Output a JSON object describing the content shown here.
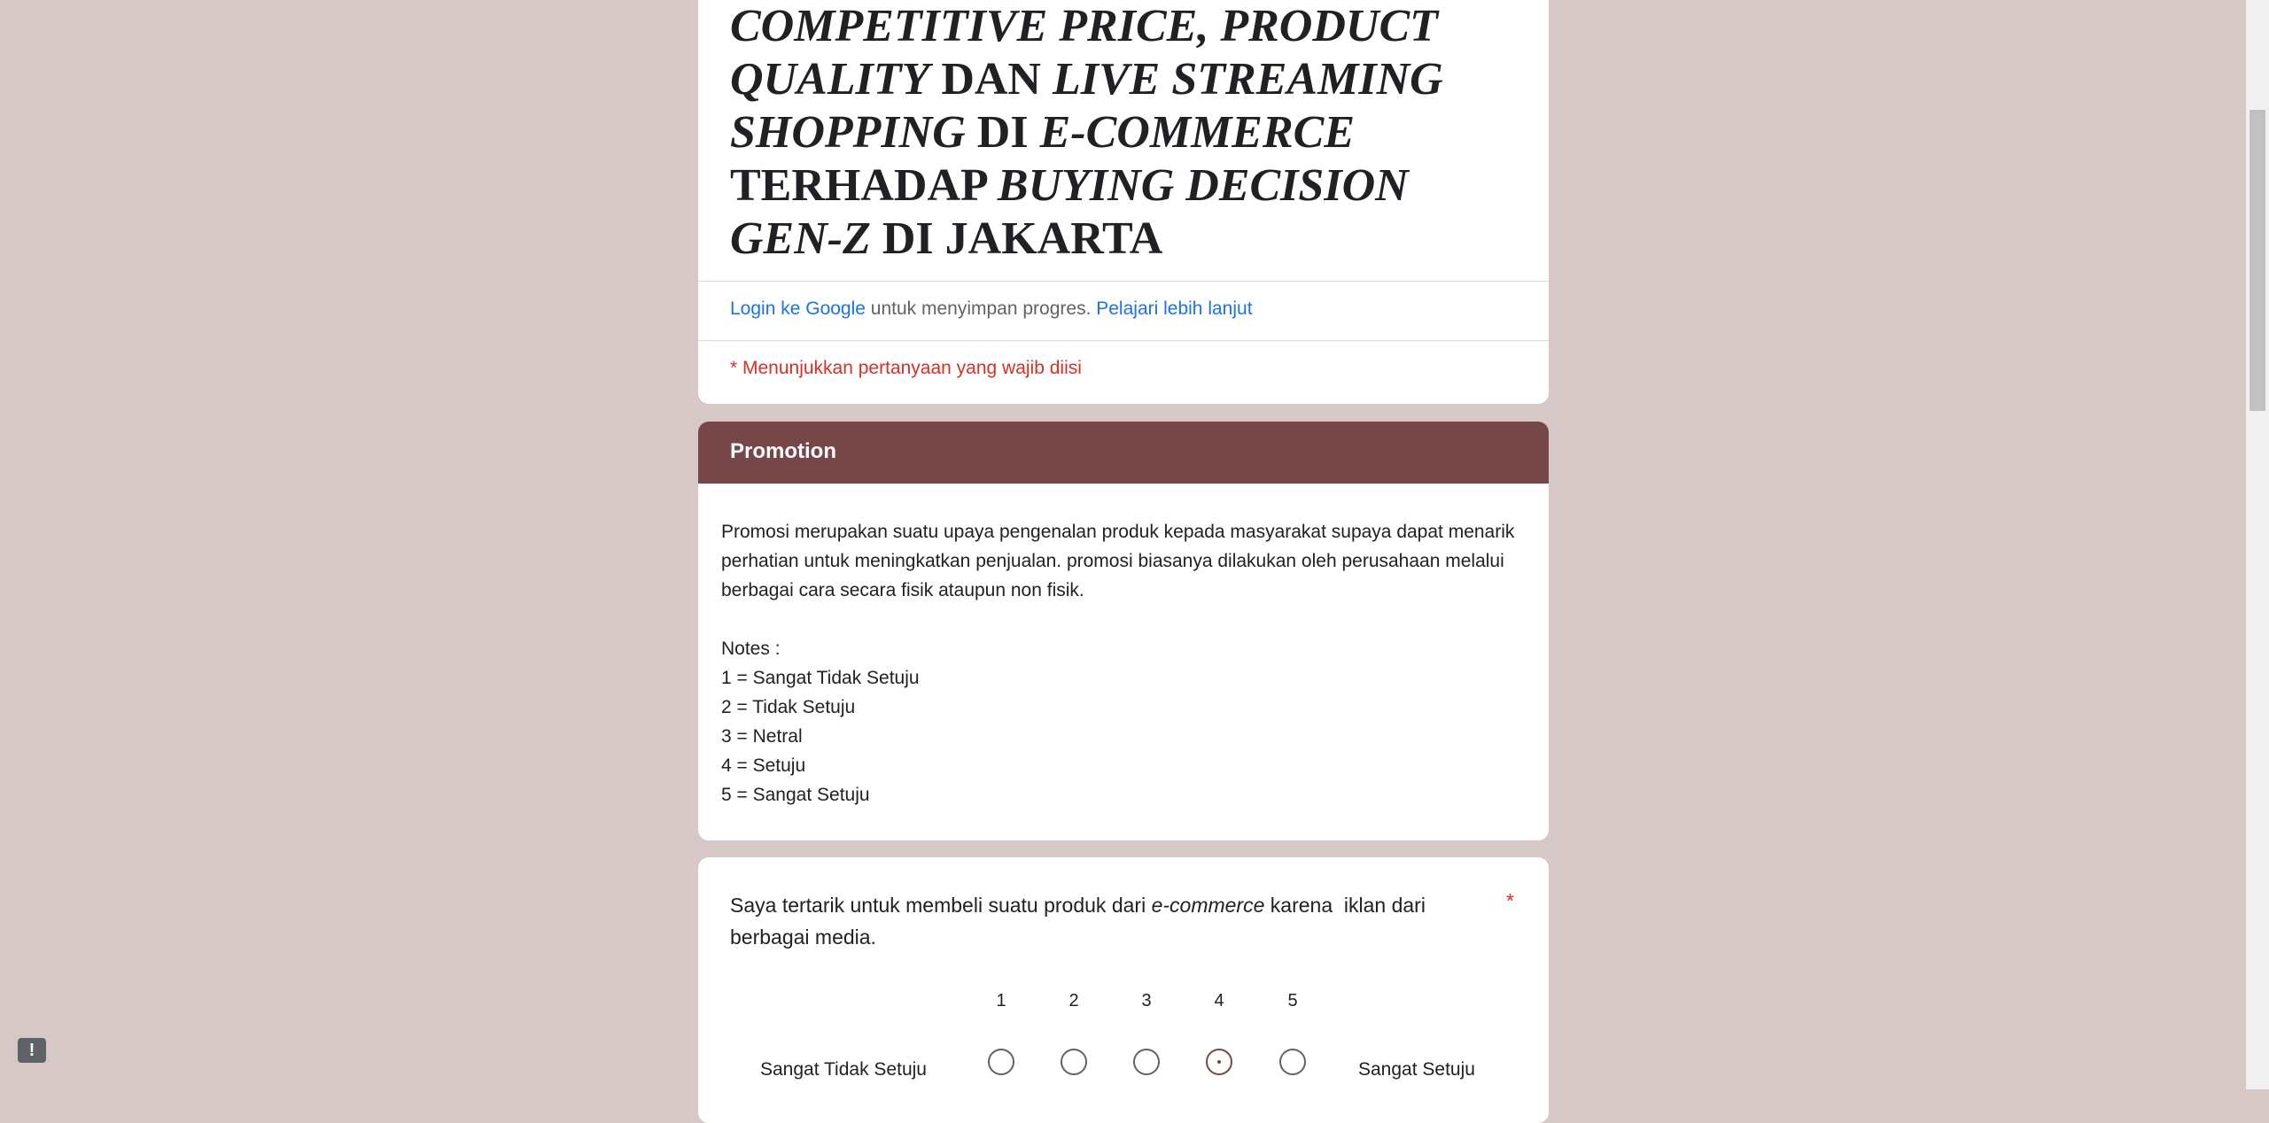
{
  "form": {
    "title_parts": [
      {
        "text": "COMPETITIVE PRICE, PRODUCT QUALITY",
        "italic": true
      },
      {
        "text": " DAN ",
        "italic": false
      },
      {
        "text": "LIVE STREAMING SHOPPING",
        "italic": true
      },
      {
        "text": " DI ",
        "italic": false
      },
      {
        "text": "E-COMMERCE",
        "italic": true
      },
      {
        "text": " TERHADAP ",
        "italic": false
      },
      {
        "text": "BUYING DECISION GEN-Z",
        "italic": true
      },
      {
        "text": " DI JAKARTA",
        "italic": false
      }
    ],
    "login_link": "Login ke Google",
    "login_text": " untuk menyimpan progres. ",
    "learn_more": "Pelajari lebih lanjut",
    "required_note": "* Menunjukkan pertanyaan yang wajib diisi"
  },
  "section": {
    "title": "Promotion",
    "description": "Promosi merupakan suatu upaya pengenalan produk kepada masyarakat supaya dapat menarik perhatian untuk meningkatkan penjualan. promosi biasanya dilakukan oleh perusahaan melalui berbagai cara secara fisik ataupun non fisik.",
    "notes_label": "Notes :",
    "notes": [
      "1 = Sangat Tidak Setuju",
      "2 = Tidak Setuju",
      "3 = Netral",
      "4 = Setuju",
      "5 = Sangat Setuju"
    ]
  },
  "question": {
    "text_before": "Saya tertarik untuk membeli suatu produk dari ",
    "text_italic": "e-commerce",
    "text_after": " karena  iklan dari berbagai media.",
    "required_marker": "*",
    "scale": [
      "1",
      "2",
      "3",
      "4",
      "5"
    ],
    "low_label": "Sangat Tidak Setuju",
    "high_label": "Sangat Setuju",
    "hovered_option": "4"
  },
  "feedback_icon": "!",
  "colors": {
    "background": "#d7c8c8",
    "accent": "#764649",
    "link": "#1a73e8",
    "required": "#d93025"
  }
}
